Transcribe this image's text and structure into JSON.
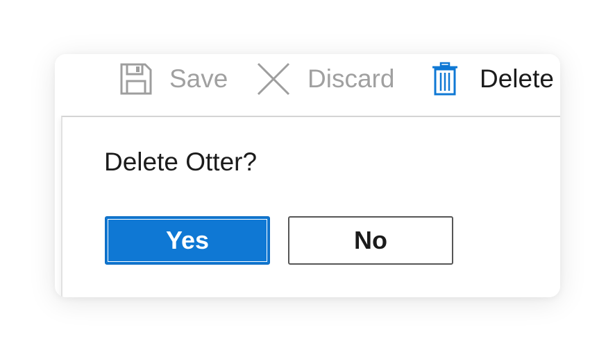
{
  "toolbar": {
    "save": {
      "label": "Save",
      "icon": "save-icon",
      "state": "disabled"
    },
    "discard": {
      "label": "Discard",
      "icon": "close-icon",
      "state": "disabled"
    },
    "delete": {
      "label": "Delete",
      "icon": "trash-icon",
      "state": "enabled"
    }
  },
  "dialog": {
    "prompt": "Delete Otter?",
    "yes_label": "Yes",
    "no_label": "No"
  },
  "colors": {
    "accent": "#0f78d4",
    "disabled_text": "#a0a0a0",
    "text": "#1b1b1b",
    "icon_disabled": "#9e9e9e",
    "icon_delete": "#0f78d4"
  }
}
